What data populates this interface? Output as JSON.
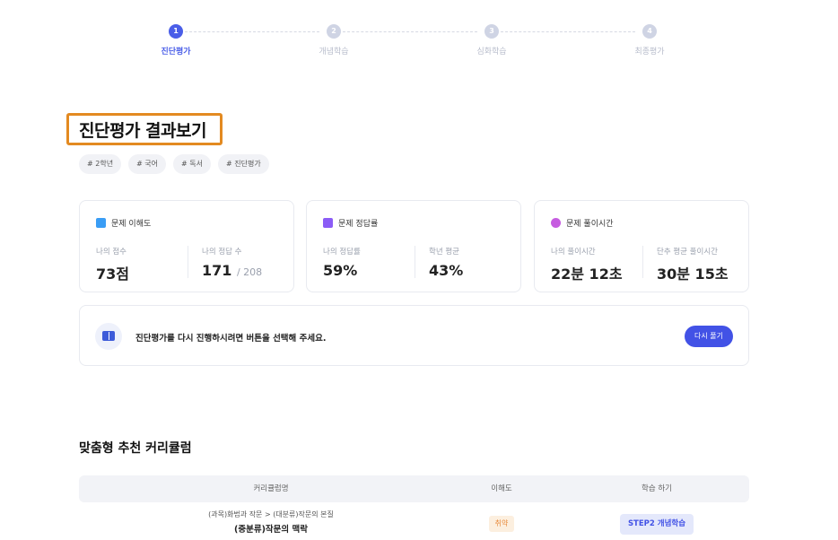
{
  "stepper": {
    "steps": [
      {
        "num": "1",
        "label": "진단평가"
      },
      {
        "num": "2",
        "label": "개념학습"
      },
      {
        "num": "3",
        "label": "심화학습"
      },
      {
        "num": "4",
        "label": "최종평가"
      }
    ],
    "active_step": 1
  },
  "page": {
    "title": "진단평가 결과보기",
    "tags": [
      "# 2학년",
      "# 국어",
      "# 독서",
      "# 진단평가"
    ]
  },
  "cards": {
    "understanding": {
      "title": "문제 이해도",
      "my_score_label": "나의 점수",
      "my_score_value": "73점",
      "correct_label": "나의 정답 수",
      "correct_value": "171",
      "correct_total": "/ 208"
    },
    "accuracy": {
      "title": "문제 정답률",
      "my_rate_label": "나의 정답률",
      "my_rate_value": "59%",
      "grade_avg_label": "학년 평균",
      "grade_avg_value": "43%"
    },
    "time": {
      "title": "문제 풀이시간",
      "my_time_label": "나의 풀이시간",
      "my_time_value": "22분 12초",
      "avg_time_label": "단추 평균 풀이시간",
      "avg_time_value": "30분 15초"
    }
  },
  "notice": {
    "text": "진단평가를 다시 진행하시려면 버튼을 선택해 주세요.",
    "button": "다시 풀기"
  },
  "curriculum": {
    "title": "맞춤형 추천 커리큘럼",
    "headers": [
      "커리큘럼명",
      "이해도",
      "학습 하기"
    ],
    "rows": [
      {
        "path": "(과목)화법과 작문 > (대분류)작문의 본질",
        "name": "(중분류)작문의 맥락",
        "level": "취약",
        "action": "STEP2 개념학습"
      }
    ]
  },
  "colors": {
    "accent": "#4252e6",
    "highlight_box": "#e38a21",
    "weak_badge": "#e88a3b"
  }
}
